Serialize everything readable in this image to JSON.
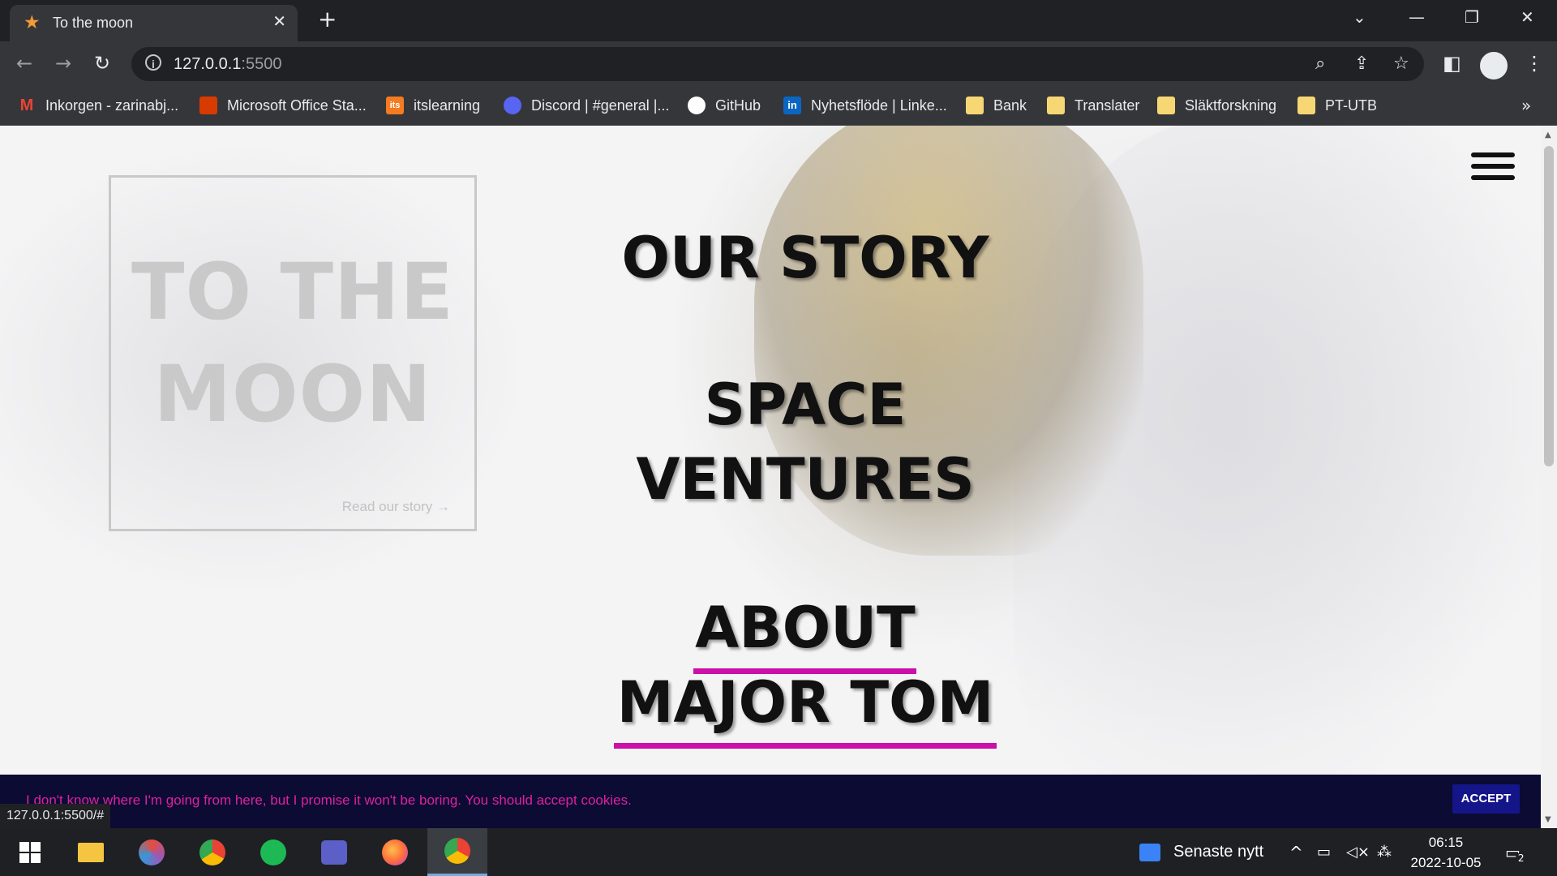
{
  "browser": {
    "tab_title": "To the moon",
    "url_host": "127.0.0.1",
    "url_port": ":5500",
    "bookmarks": [
      {
        "label": "Inkorgen - zarinabj...",
        "icon": "gmail-icon",
        "color": "#ea4335"
      },
      {
        "label": "Microsoft Office Sta...",
        "icon": "office-icon",
        "color": "#d83b01"
      },
      {
        "label": "itslearning",
        "icon": "itslearning-icon",
        "color": "#f47b20"
      },
      {
        "label": "Discord | #general |...",
        "icon": "discord-icon",
        "color": "#5865f2"
      },
      {
        "label": "GitHub",
        "icon": "github-icon",
        "color": "#ffffff"
      },
      {
        "label": "Nyhetsflöde | Linke...",
        "icon": "linkedin-icon",
        "color": "#0a66c2"
      },
      {
        "label": "Bank",
        "icon": "folder-icon",
        "color": "#f7d774"
      },
      {
        "label": "Translater",
        "icon": "folder-icon",
        "color": "#f7d774"
      },
      {
        "label": "Släktforskning",
        "icon": "folder-icon",
        "color": "#f7d774"
      },
      {
        "label": "PT-UTB",
        "icon": "folder-icon",
        "color": "#f7d774"
      }
    ],
    "status_url": "127.0.0.1:5500/#"
  },
  "page": {
    "logo_line1": "TO THE",
    "logo_line2": "MOON",
    "story_link": "Read our story →",
    "nav": [
      {
        "line1": "OUR STORY",
        "line2": "",
        "active": false
      },
      {
        "line1": "SPACE",
        "line2": "VENTURES",
        "active": false
      },
      {
        "line1": "ABOUT",
        "line2": "MAJOR TOM",
        "active": true
      }
    ],
    "accent_color": "#cc0fa8",
    "cookie_text": "I don't know where I'm going from here, but I promise it won't be boring. You should accept cookies.",
    "cookie_button": "ACCEPT"
  },
  "taskbar": {
    "news": "Senaste nytt",
    "time": "06:15",
    "date": "2022-10-05",
    "notification_count": "2"
  }
}
